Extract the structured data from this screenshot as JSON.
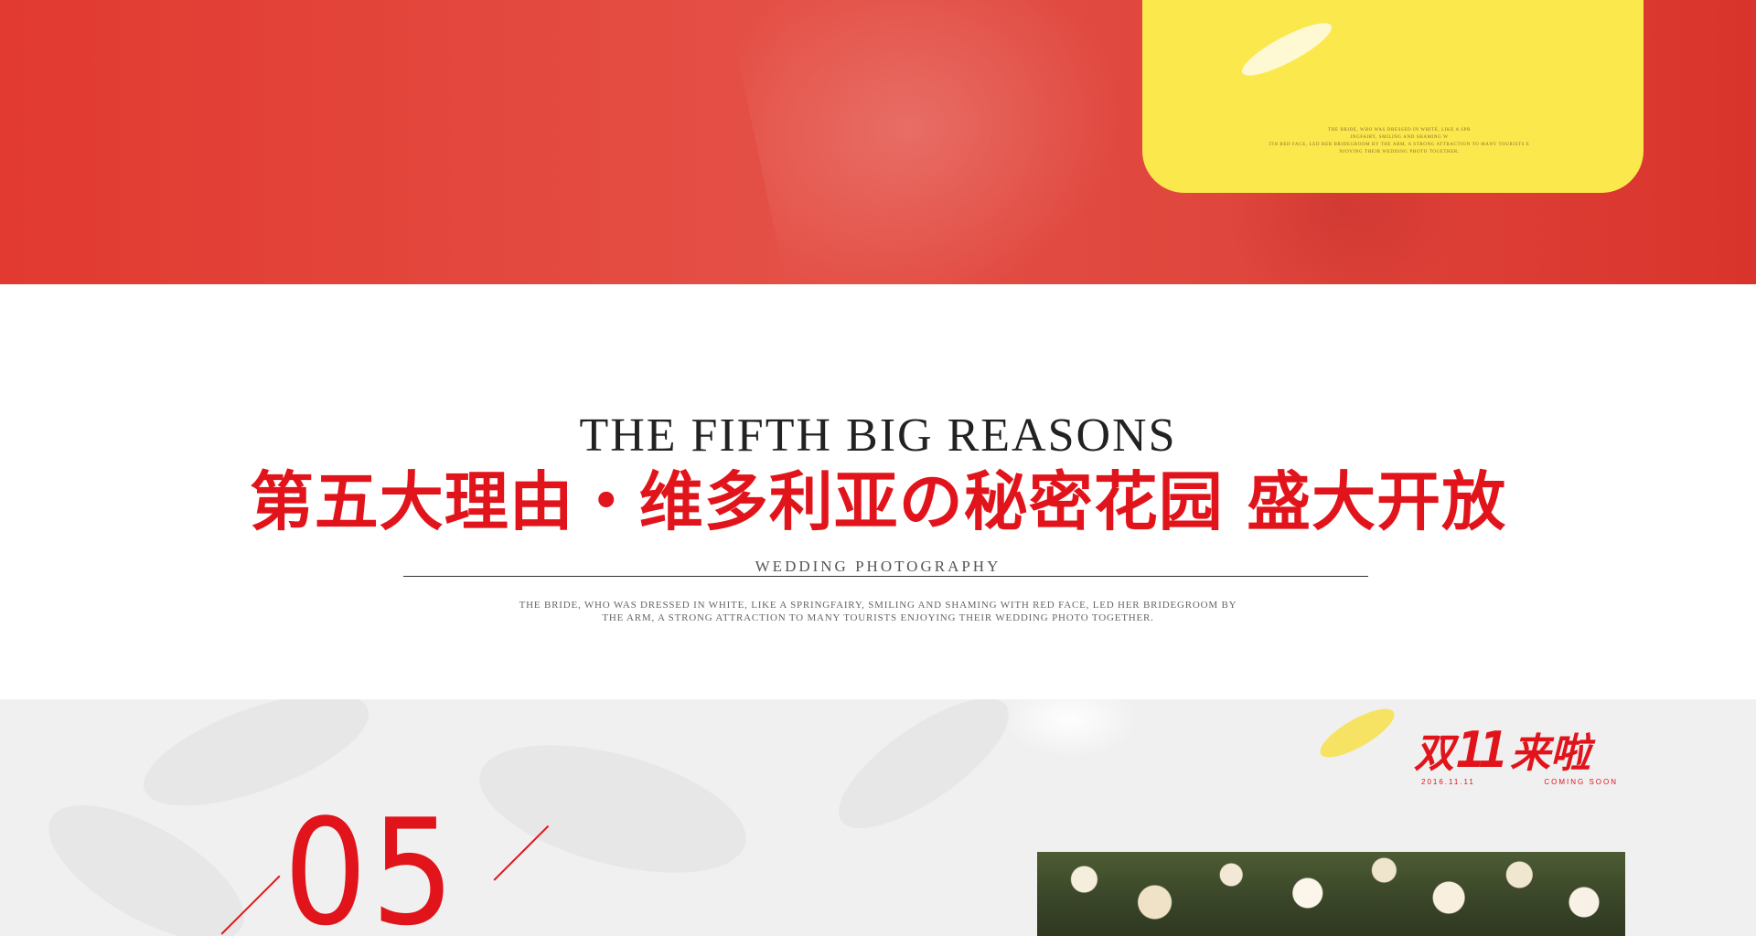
{
  "top": {
    "card_text_lines": [
      "THE BRIDE, WHO WAS DRESSED IN WHITE, LIKE A SPR",
      "INGFAIRY, SMILING AND SHAMING W",
      "ITH RED FACE, LED HER BRIDEGROOM BY THE ARM, A STRONG ATTRACTION TO MANY TOURISTS E",
      "NJOYING THEIR WEDDING PHOTO TOGETHER."
    ]
  },
  "section": {
    "en_title": "THE FIFTH BIG REASONS",
    "cn_title": "第五大理由・维多利亚の秘密花园 盛大开放",
    "sub_label": "WEDDING PHOTOGRAPHY",
    "description": "THE BRIDE, WHO WAS DRESSED IN WHITE, LIKE A SPRINGFAIRY, SMILING AND SHAMING WITH RED FACE, LED HER BRIDEGROOM BY THE ARM, A STRONG ATTRACTION TO MANY TOURISTS ENJOYING THEIR WEDDING PHOTO TOGETHER."
  },
  "promo": {
    "left_text": "双",
    "eleven": "11",
    "right_text": "来啦",
    "date": "2016.11.11",
    "coming": "COMING SOON"
  },
  "number": "05",
  "colors": {
    "brand_red": "#e1141b",
    "top_red": "#e23a30",
    "card_yellow": "#fbe84d",
    "bottom_gray": "#f0f0f0"
  }
}
